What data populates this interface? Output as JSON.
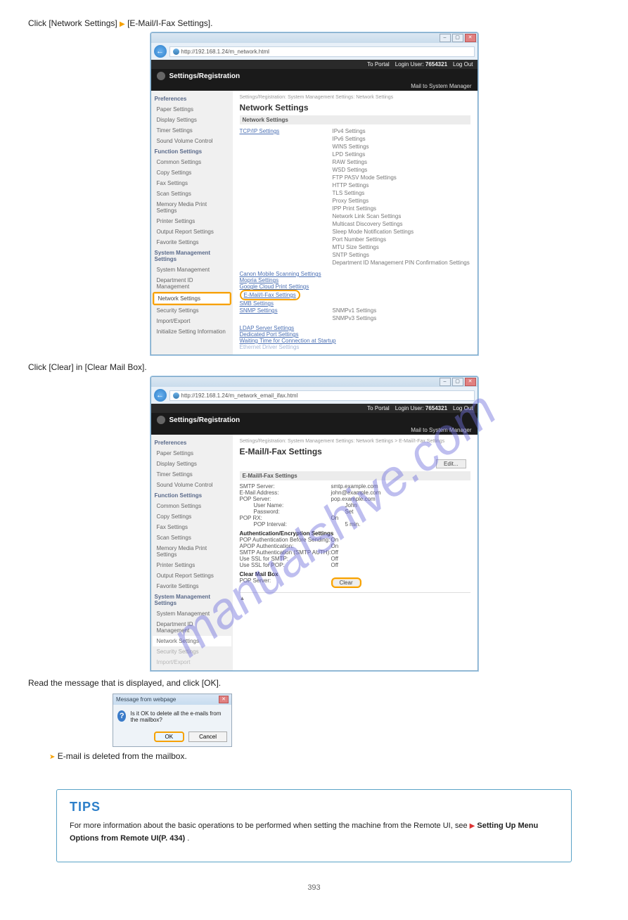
{
  "steps": {
    "s2": "Click [Network Settings]  [E-Mail/I-Fax Settings].",
    "s2_a": "Click [Network Settings] ",
    "s2_b": " [E-Mail/I-Fax Settings].",
    "s3": "Click [Clear] in [Clear Mail Box].",
    "s4": "Read the message that is displayed, and click [OK].",
    "s4_result": "E-mail is deleted from the mailbox."
  },
  "browser": {
    "url1": "http://192.168.1.24/m_network.html",
    "url2": "http://192.168.1.24/m_network_email_ifax.html"
  },
  "topstrip": {
    "portal": "To Portal",
    "login": "Login User:",
    "user": "7654321",
    "logout": "Log Out"
  },
  "header": {
    "title": "Settings/Registration",
    "mailto": "Mail to System Manager"
  },
  "sidebar": {
    "prefs": "Preferences",
    "items_pref": [
      "Paper Settings",
      "Display Settings",
      "Timer Settings",
      "Sound Volume Control"
    ],
    "func": "Function Settings",
    "items_func": [
      "Common Settings",
      "Copy Settings",
      "Fax Settings",
      "Scan Settings",
      "Memory Media Print Settings",
      "Printer Settings",
      "Output Report Settings",
      "Favorite Settings"
    ],
    "sys": "System Management Settings",
    "items_sys": [
      "System Management",
      "Department ID Management",
      "Network Settings",
      "Security Settings",
      "Import/Export",
      "Initialize Setting Information"
    ]
  },
  "screen1": {
    "crumb": "Settings/Registration: System Management Settings: Network Settings",
    "h1": "Network Settings",
    "band": "Network Settings",
    "tcp": "TCP/IP Settings",
    "tcp_sub": [
      "IPv4 Settings",
      "IPv6 Settings",
      "WINS Settings",
      "LPD Settings",
      "RAW Settings",
      "WSD Settings",
      "FTP PASV Mode Settings",
      "HTTP Settings",
      "TLS Settings",
      "Proxy Settings",
      "IPP Print Settings",
      "Network Link Scan Settings",
      "Multicast Discovery Settings",
      "Sleep Mode Notification Settings",
      "Port Number Settings",
      "MTU Size Settings",
      "SNTP Settings",
      "Department ID Management PIN Confirmation Settings"
    ],
    "links": [
      "Canon Mobile Scanning Settings",
      "Mopria Settings",
      "Google Cloud Print Settings",
      "E-Mail/I-Fax Settings",
      "SMB Settings",
      "SNMP Settings"
    ],
    "snmp_sub": [
      "SNMPv1 Settings",
      "SNMPv3 Settings"
    ],
    "more": [
      "LDAP Server Settings",
      "Dedicated Port Settings",
      "Waiting Time for Connection at Startup",
      "Ethernet Driver Settings"
    ]
  },
  "screen2": {
    "crumb": "Settings/Registration: System Management Settings: Network Settings > E-Mail/I-Fax Settings",
    "h1": "E-Mail/I-Fax Settings",
    "edit": "Edit...",
    "band": "E-Mail/I-Fax Settings",
    "rows": [
      {
        "k": "SMTP Server:",
        "v": "smtp.example.com"
      },
      {
        "k": "E-Mail Address:",
        "v": "john@example.com"
      },
      {
        "k": "POP Server:",
        "v": "pop.example.com"
      },
      {
        "k": "User Name:",
        "v": "John"
      },
      {
        "k": "Password:",
        "v": "Set"
      },
      {
        "k": "POP RX:",
        "v": "On"
      },
      {
        "k": "POP Interval:",
        "v": "5 min."
      }
    ],
    "auth_head": "Authentication/Encryption Settings",
    "auth_rows": [
      {
        "k": "POP Authentication Before Sending:",
        "v": "On"
      },
      {
        "k": "APOP Authentication:",
        "v": "On"
      },
      {
        "k": "SMTP Authentication (SMTP AUTH):",
        "v": "Off"
      },
      {
        "k": "Use SSL for SMTP:",
        "v": "Off"
      },
      {
        "k": "Use SSL for POP:",
        "v": "Off"
      }
    ],
    "clear_head": "Clear Mail Box",
    "clear_row_k": "POP Server:",
    "clear_btn": "Clear"
  },
  "dialog": {
    "title": "Message from webpage",
    "msg": "Is it OK to delete all the e-mails from the mailbox?",
    "ok": "OK",
    "cancel": "Cancel"
  },
  "tips": {
    "head": "TIPS",
    "line1": "For more information about the basic operations to be performed when setting the machine from the Remote UI, see ",
    "link": "Setting Up Menu Options from Remote UI(P. 434)",
    "line2": " ."
  },
  "footer": {
    "page": "393"
  },
  "watermark": "manualshive.com"
}
